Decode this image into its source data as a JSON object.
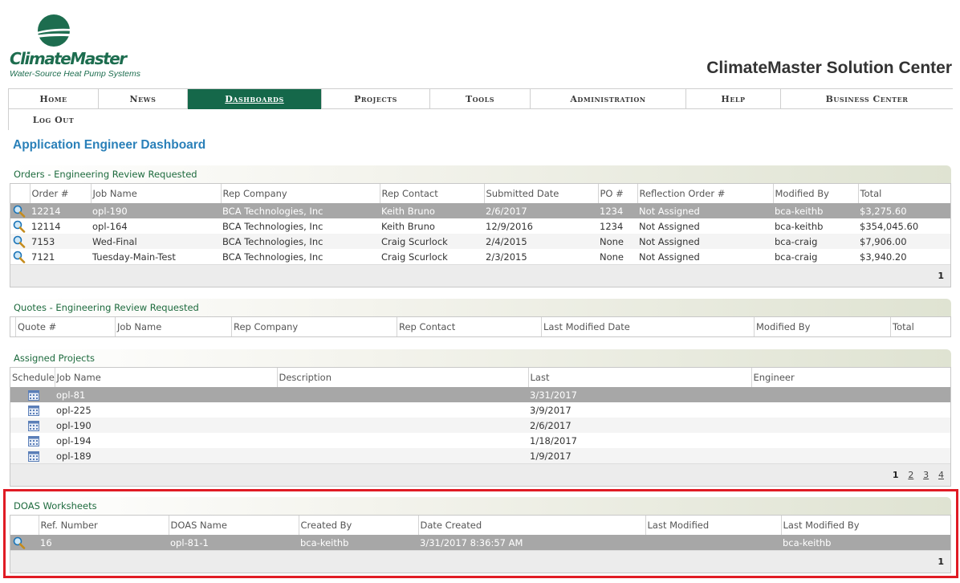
{
  "brand": {
    "logo_name": "ClimateMaster",
    "logo_tagline": "Water-Source Heat Pump Systems",
    "site_title": "ClimateMaster Solution Center",
    "brand_color": "#15684a"
  },
  "nav": {
    "items": [
      "Home",
      "News",
      "Dashboards",
      "Projects",
      "Tools",
      "Administration",
      "Help",
      "Business Center"
    ],
    "active": "Dashboards",
    "logout": "Log Out"
  },
  "page": {
    "heading": "Application Engineer Dashboard"
  },
  "orders": {
    "title": "Orders - Engineering Review Requested",
    "columns": [
      "Order #",
      "Job Name",
      "Rep Company",
      "Rep Contact",
      "Submitted Date",
      "PO #",
      "Reflection Order #",
      "Modified By",
      "Total"
    ],
    "rows": [
      [
        "12214",
        "opl-190",
        "BCA Technologies, Inc",
        "Keith Bruno",
        "2/6/2017",
        "1234",
        "Not Assigned",
        "bca-keithb",
        "$3,275.60"
      ],
      [
        "12114",
        "opl-164",
        "BCA Technologies, Inc",
        "Keith Bruno",
        "12/9/2016",
        "1234",
        "Not Assigned",
        "bca-keithb",
        "$354,045.60"
      ],
      [
        "7153",
        "Wed-Final",
        "BCA Technologies, Inc",
        "Craig Scurlock",
        "2/4/2015",
        "None",
        "Not Assigned",
        "bca-craig",
        "$7,906.00"
      ],
      [
        "7121",
        "Tuesday-Main-Test",
        "BCA Technologies, Inc",
        "Craig Scurlock",
        "2/3/2015",
        "None",
        "Not Assigned",
        "bca-craig",
        "$3,940.20"
      ]
    ],
    "pager": "1"
  },
  "quotes": {
    "title": "Quotes - Engineering Review Requested",
    "columns": [
      "Quote #",
      "Job Name",
      "Rep Company",
      "Rep Contact",
      "Last Modified Date",
      "Modified By",
      "Total"
    ]
  },
  "projects": {
    "title": "Assigned Projects",
    "columns": [
      "Schedule",
      "Job Name",
      "Description",
      "Last",
      "Engineer"
    ],
    "rows": [
      [
        "opl-81",
        "",
        "3/31/2017",
        ""
      ],
      [
        "opl-225",
        "",
        "3/9/2017",
        ""
      ],
      [
        "opl-190",
        "",
        "2/6/2017",
        ""
      ],
      [
        "opl-194",
        "",
        "1/18/2017",
        ""
      ],
      [
        "opl-189",
        "",
        "1/9/2017",
        ""
      ]
    ],
    "pages": [
      "1",
      "2",
      "3",
      "4"
    ]
  },
  "doas": {
    "title": "DOAS Worksheets",
    "columns": [
      "Ref. Number",
      "DOAS Name",
      "Created By",
      "Date Created",
      "Last Modified",
      "Last Modified By"
    ],
    "rows": [
      [
        "16",
        "opl-81-1",
        "bca-keithb",
        "3/31/2017 8:36:57 AM",
        "",
        "bca-keithb"
      ]
    ],
    "pager": "1"
  }
}
